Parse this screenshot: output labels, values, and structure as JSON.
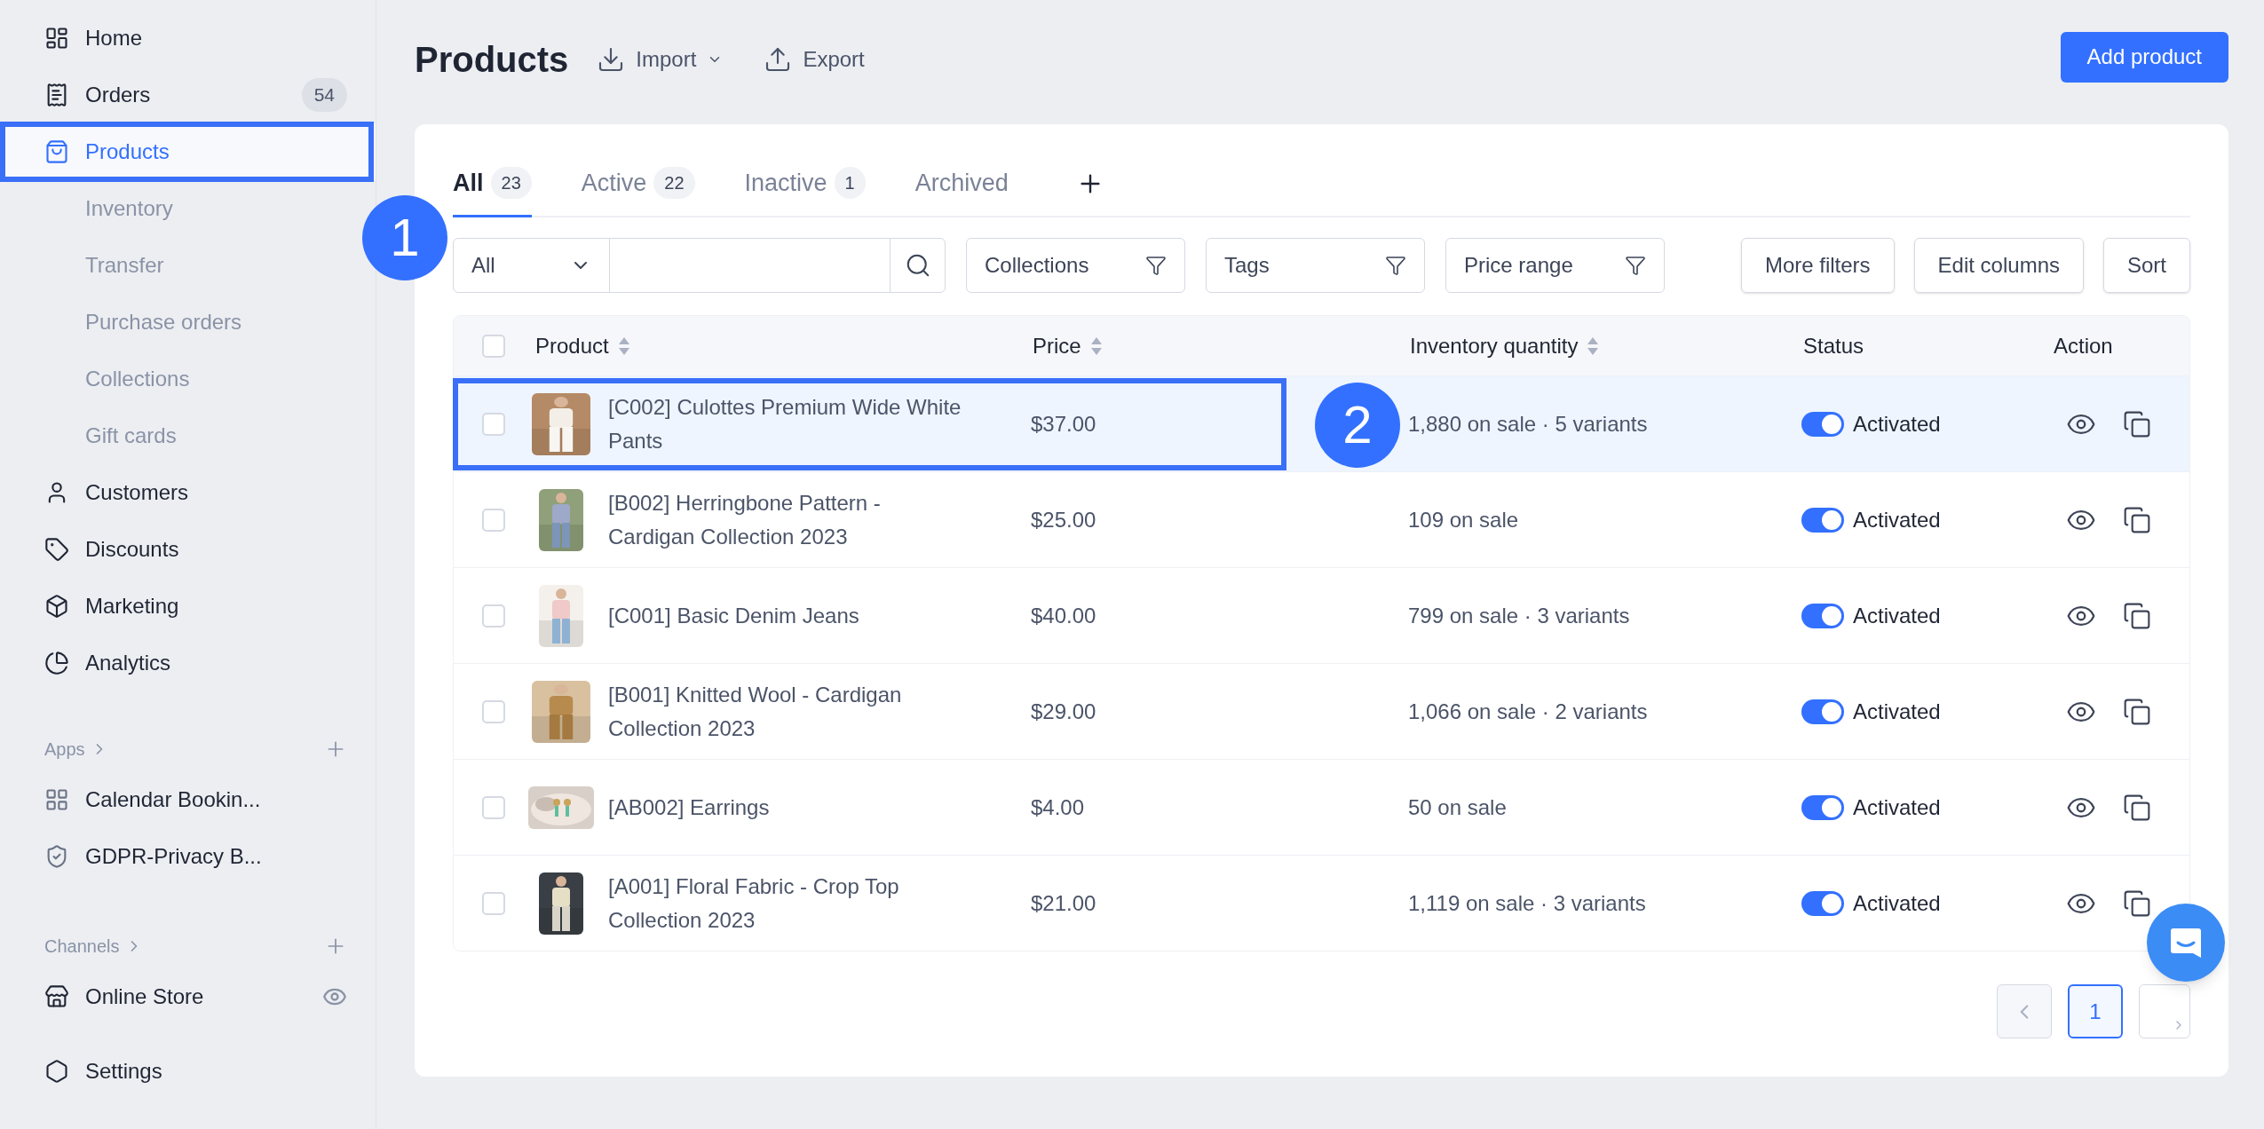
{
  "sidebar": {
    "items": [
      {
        "label": "Home",
        "kind": "main",
        "selected": false
      },
      {
        "label": "Orders",
        "kind": "main",
        "selected": false,
        "badge": "54"
      },
      {
        "label": "Products",
        "kind": "main",
        "selected": true
      },
      {
        "label": "Inventory",
        "kind": "sub",
        "selected": false
      },
      {
        "label": "Transfer",
        "kind": "sub",
        "selected": false
      },
      {
        "label": "Purchase orders",
        "kind": "sub",
        "selected": false
      },
      {
        "label": "Collections",
        "kind": "sub",
        "selected": false
      },
      {
        "label": "Gift cards",
        "kind": "sub",
        "selected": false
      },
      {
        "label": "Customers",
        "kind": "main",
        "selected": false
      },
      {
        "label": "Discounts",
        "kind": "main",
        "selected": false
      },
      {
        "label": "Marketing",
        "kind": "main",
        "selected": false
      },
      {
        "label": "Analytics",
        "kind": "main",
        "selected": false
      }
    ],
    "sections": [
      {
        "title": "Apps",
        "items": [
          {
            "label": "Calendar Bookin..."
          },
          {
            "label": "GDPR-Privacy B..."
          }
        ]
      },
      {
        "title": "Channels",
        "items": [
          {
            "label": "Online Store"
          }
        ]
      }
    ],
    "settings": {
      "label": "Settings"
    }
  },
  "header": {
    "title": "Products",
    "actions": [
      {
        "label": "Import",
        "dropdown": true
      },
      {
        "label": "Export",
        "dropdown": false
      }
    ],
    "primary": "Add product"
  },
  "tabs": [
    {
      "label": "All",
      "count": "23",
      "selected": true
    },
    {
      "label": "Active",
      "count": "22",
      "selected": false
    },
    {
      "label": "Inactive",
      "count": "1",
      "selected": false
    },
    {
      "label": "Archived",
      "selected": false
    }
  ],
  "filters": {
    "scope": "All",
    "filter_buttons": [
      "Collections",
      "Tags",
      "Price range"
    ],
    "buttons": [
      "More filters",
      "Edit columns",
      "Sort"
    ]
  },
  "table": {
    "select_all": {
      "checked": false
    },
    "columns": [
      {
        "label": "Product",
        "sortable": true
      },
      {
        "label": "Price",
        "sortable": true
      },
      {
        "label": "Inventory quantity",
        "sortable": true
      },
      {
        "label": "Status",
        "sortable": false
      },
      {
        "label": "Action",
        "sortable": false
      }
    ],
    "rows": [
      {
        "product": "[C002] Culottes Premium Wide White Pants",
        "price": "$37.00",
        "inventory": "1,880 on sale · 5 variants",
        "status": "Activated",
        "on": true,
        "checked": false,
        "highlighted": true
      },
      {
        "product": "[B002] Herringbone Pattern - Cardigan Collection 2023",
        "price": "$25.00",
        "inventory": "109 on sale",
        "status": "Activated",
        "on": true,
        "checked": false,
        "highlighted": false
      },
      {
        "product": "[C001] Basic Denim Jeans",
        "price": "$40.00",
        "inventory": "799 on sale · 3 variants",
        "status": "Activated",
        "on": true,
        "checked": false,
        "highlighted": false
      },
      {
        "product": "[B001] Knitted Wool - Cardigan Collection 2023",
        "price": "$29.00",
        "inventory": "1,066 on sale · 2 variants",
        "status": "Activated",
        "on": true,
        "checked": false,
        "highlighted": false
      },
      {
        "product": "[AB002] Earrings",
        "price": "$4.00",
        "inventory": "50 on sale",
        "status": "Activated",
        "on": true,
        "checked": false,
        "highlighted": false
      },
      {
        "product": "[A001] Floral Fabric - Crop Top Collection 2023",
        "price": "$21.00",
        "inventory": "1,119 on sale · 3 variants",
        "status": "Activated",
        "on": true,
        "checked": false,
        "highlighted": false
      }
    ]
  },
  "pagination": {
    "pages": [
      {
        "label": "1",
        "selected": true
      }
    ]
  },
  "annotations": [
    {
      "label": "1"
    },
    {
      "label": "2"
    }
  ]
}
